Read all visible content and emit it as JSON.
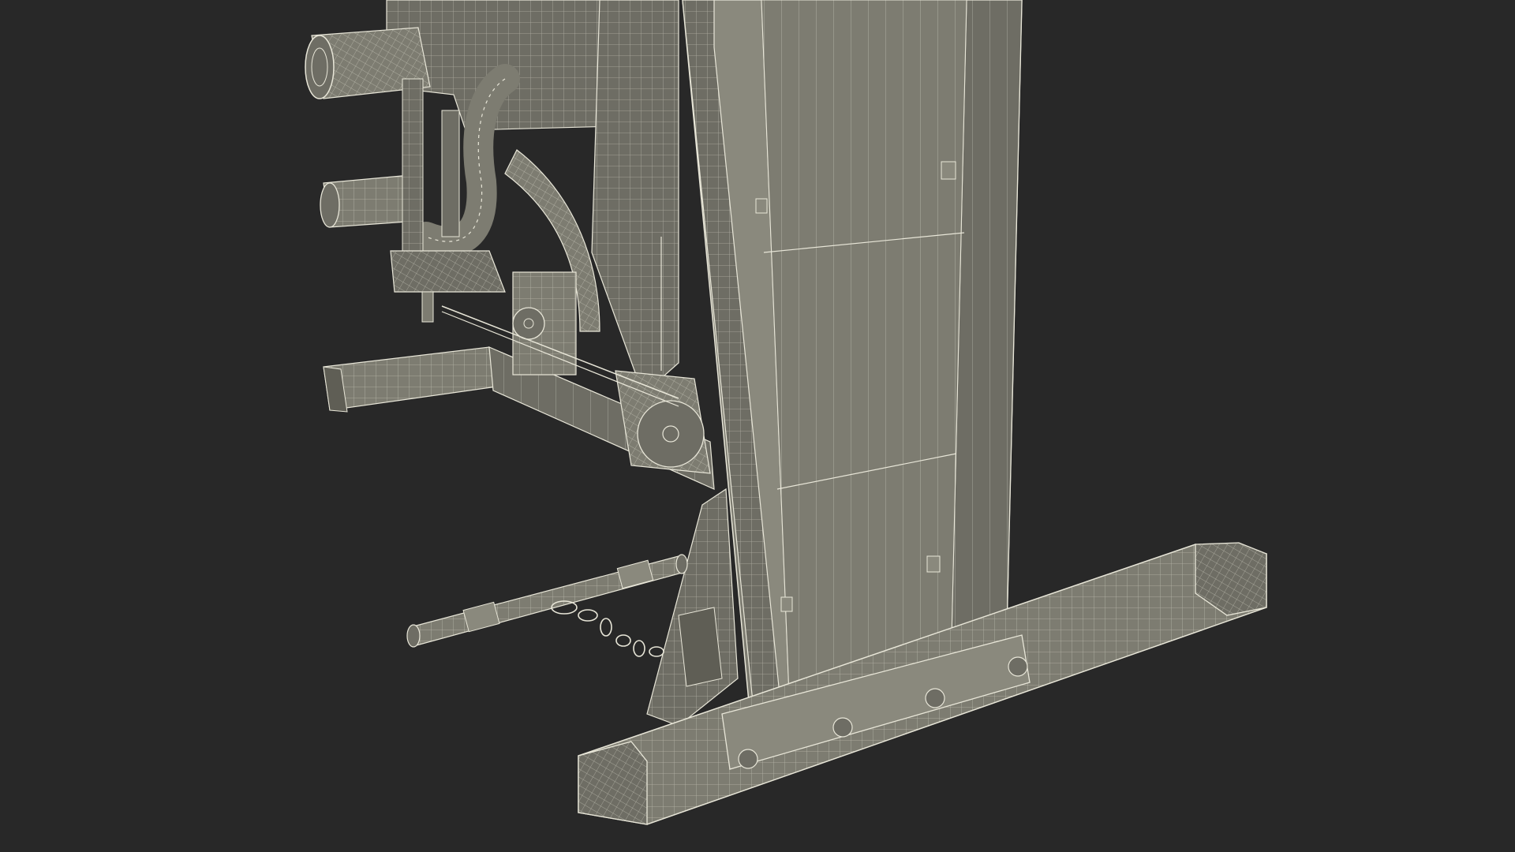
{
  "scene": {
    "subject": "home-gym-machine-wireframe",
    "background_color": "#282828",
    "surface_color": "#7d7c71",
    "surface_shadow_color": "#5f5e55",
    "wire_color": "#e8e6d8",
    "pad_color": "#6e6d64"
  }
}
